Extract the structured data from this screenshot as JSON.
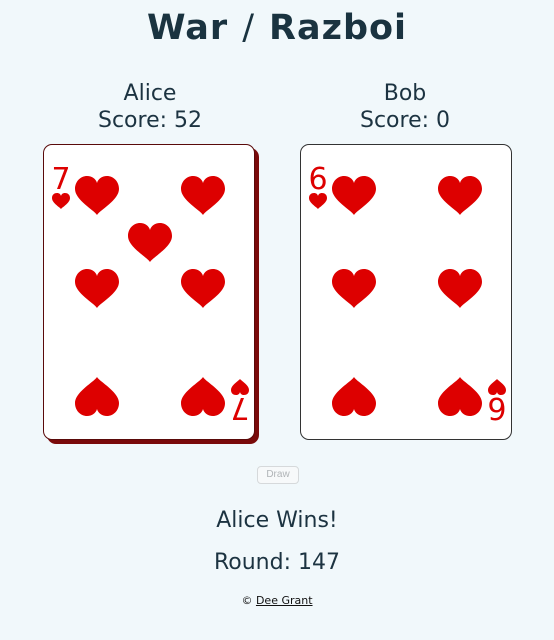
{
  "title": {
    "left": "War",
    "separator": "/",
    "right": "Razboi"
  },
  "players": [
    {
      "name": "Alice",
      "score_label": "Score: 52",
      "card": {
        "rank": "7",
        "suit": "hearts",
        "color": "#dd0000"
      }
    },
    {
      "name": "Bob",
      "score_label": "Score: 0",
      "card": {
        "rank": "6",
        "suit": "hearts",
        "color": "#dd0000"
      }
    }
  ],
  "controls": {
    "draw_label": "Draw"
  },
  "result_text": "Alice Wins!",
  "round_text": "Round: 147",
  "footer": {
    "copyright": "©",
    "author": "Dee Grant"
  }
}
